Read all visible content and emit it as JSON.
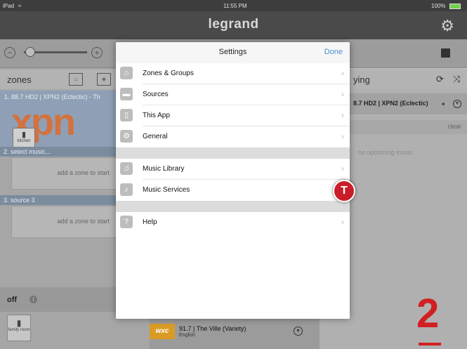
{
  "status_bar": {
    "device": "iPad",
    "time": "11:55 PM",
    "battery": "100%"
  },
  "app": {
    "title": "legrand"
  },
  "zones": {
    "header": "zones",
    "zone1_label": "1. 88.7 HD2 | XPN2 (Eclectic) - Th",
    "zone1_art_text": "xpn",
    "zone1_room": "kitchen",
    "zone2_label": "2. select music...",
    "zone2_placeholder": "add a zone to start",
    "zone3_label": "3. source 3",
    "zone3_placeholder": "add a zone to start",
    "off_label": "off",
    "off_room": "family room"
  },
  "now_playing": {
    "header": "ying",
    "station": "8.7 HD2 | XPN2 (Eclectic)",
    "clear_label": "clear",
    "upcoming": "no upcoming music",
    "bottom_station": "91.7 | The Ville (Variety)",
    "bottom_language": "English",
    "bottom_art_text": "wxc"
  },
  "settings": {
    "title": "Settings",
    "done_label": "Done",
    "items": [
      {
        "label": "Zones & Groups",
        "icon": "house-icon"
      },
      {
        "label": "Sources",
        "icon": "source-icon"
      },
      {
        "label": "This App",
        "icon": "tablet-icon"
      },
      {
        "label": "General",
        "icon": "gears-icon"
      },
      {
        "label": "Music Library",
        "icon": "music-note-icon"
      },
      {
        "label": "Music Services",
        "icon": "music-services-icon"
      },
      {
        "label": "Help",
        "icon": "help-icon"
      }
    ]
  },
  "overlay": {
    "badge_letter": "T",
    "step_number": "2"
  },
  "colors": {
    "accent": "#4a8fcf",
    "badge": "#c91e2a",
    "step": "#d21f22"
  }
}
